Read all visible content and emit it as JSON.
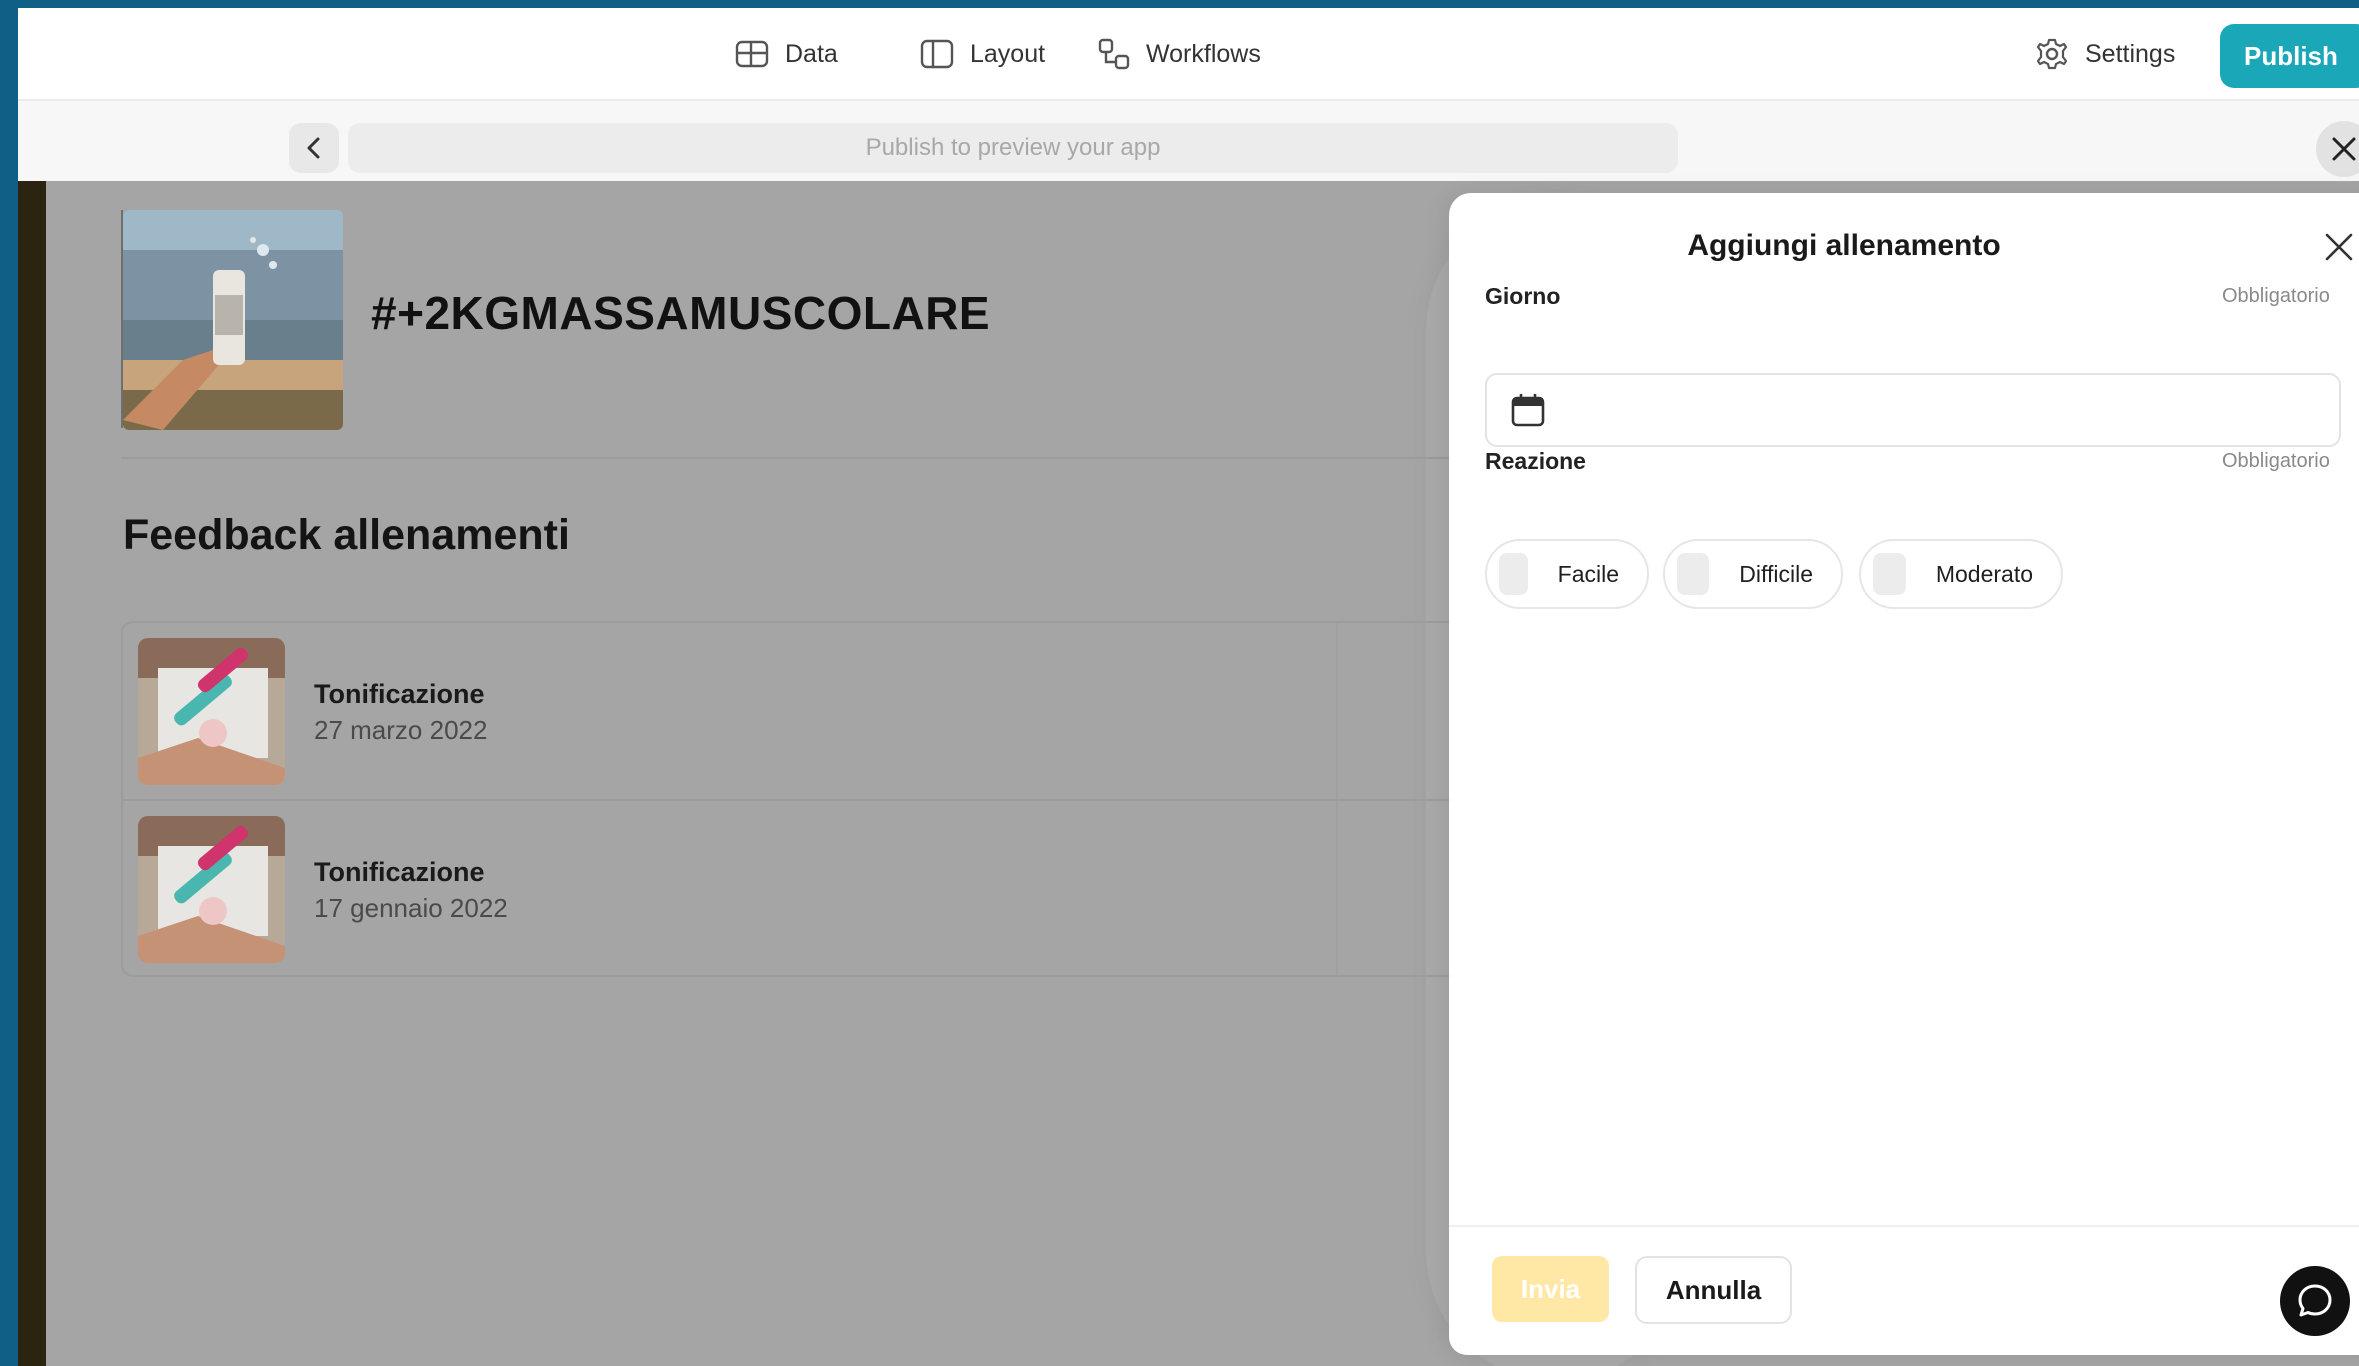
{
  "toolbar": {
    "data_label": "Data",
    "layout_label": "Layout",
    "workflows_label": "Workflows",
    "settings_label": "Settings",
    "publish_label": "Publish"
  },
  "urlbar": {
    "placeholder": "Publish to preview your app"
  },
  "app": {
    "hero_title": "#+2KGMASSAMUSCOLARE",
    "section_title": "Feedback allenamenti",
    "items": [
      {
        "title": "Tonificazione",
        "date": "27 marzo 2022"
      },
      {
        "title": "Tonificazione",
        "date": "17 gennaio 2022"
      }
    ]
  },
  "modal": {
    "title": "Aggiungi allenamento",
    "giorno_label": "Giorno",
    "giorno_required": "Obbligatorio",
    "reazione_label": "Reazione",
    "reazione_required": "Obbligatorio",
    "options": [
      "Facile",
      "Difficile",
      "Moderato"
    ],
    "submit_label": "Invia",
    "cancel_label": "Annulla"
  },
  "colors": {
    "accent": "#1aa7b7",
    "submit_disabled": "#ffe8a6",
    "overlay": "#a7a7a7",
    "frame": "#0f5f86"
  }
}
